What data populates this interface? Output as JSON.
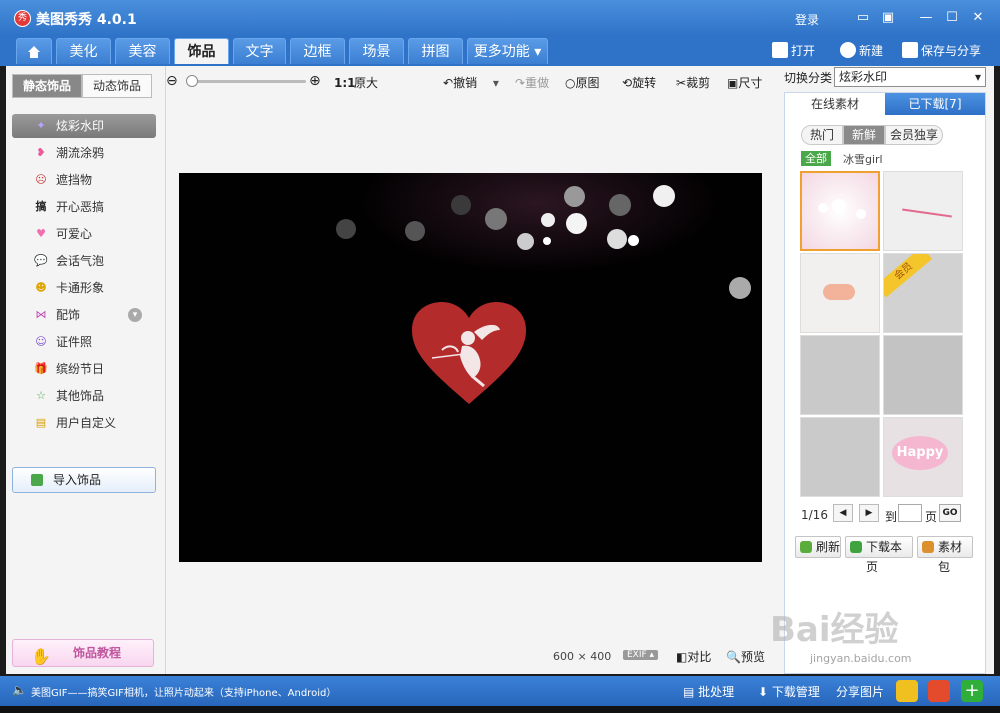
{
  "app": {
    "logo_text": "秀",
    "title": "美图秀秀 4.0.1",
    "login": "登录"
  },
  "tabs": [
    "美化",
    "美容",
    "饰品",
    "文字",
    "边框",
    "场景",
    "拼图",
    "更多功能"
  ],
  "top_actions": {
    "open": "打开",
    "new": "新建",
    "save_share": "保存与分享"
  },
  "left": {
    "seg_static": "静态饰品",
    "seg_dynamic": "动态饰品",
    "categories": [
      "炫彩水印",
      "潮流涂鸦",
      "遮挡物",
      "开心恶搞",
      "可爱心",
      "会话气泡",
      "卡通形象",
      "配饰",
      "证件照",
      "缤纷节日",
      "其他饰品",
      "用户自定义"
    ],
    "import": "导入饰品",
    "tutorial": "饰品教程"
  },
  "toolbar": {
    "ratio_icon": "1:1",
    "original_size": "原大",
    "undo": "撤销",
    "redo": "重做",
    "original": "原图",
    "rotate": "旋转",
    "crop": "裁剪",
    "size": "尺寸"
  },
  "canvas": {
    "width": "600",
    "times": "×",
    "height": "400",
    "exif": "EXIF",
    "compare": "对比",
    "preview": "预览"
  },
  "right": {
    "switch_label": "切换分类",
    "switch_value": "炫彩水印",
    "tab_online": "在线素材",
    "tab_downloaded": "已下载[7]",
    "filters": [
      "热门",
      "新鲜",
      "会员独享"
    ],
    "all": "全部",
    "author": "冰雪girl",
    "vip_badge": "会员",
    "happy_text": "Happy",
    "page": "1/16",
    "to": "到",
    "page_unit": "页",
    "go": "GO",
    "refresh": "刷新",
    "download_page": "下载本页",
    "pack": "素材包"
  },
  "bottom": {
    "news": "美图GIF——搞笑GIF相机，让照片动起来（支持iPhone、Android）",
    "batch": "批处理",
    "download_mgr": "下载管理",
    "share_pic": "分享图片"
  },
  "watermark": {
    "brand": "Bai经验",
    "url": "jingyan.baidu.com"
  },
  "colors": {
    "titlebar": "#2f73c8",
    "heart": "#b42b2c",
    "selected_thumb": "#f0a030"
  }
}
